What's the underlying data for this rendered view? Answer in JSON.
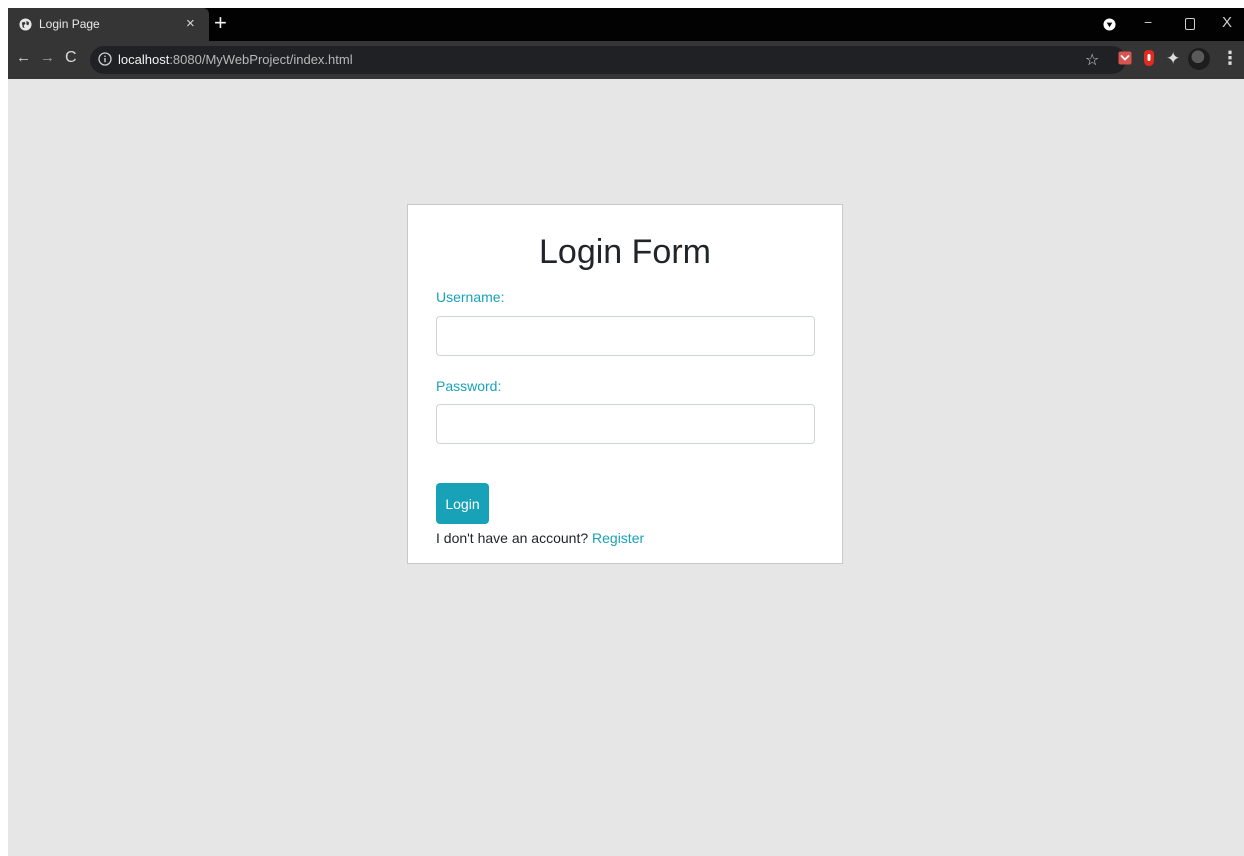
{
  "browser": {
    "tab_title": "Login Page",
    "tab_close": "×",
    "new_tab": "+",
    "url_host": "localhost",
    "url_rest": ":8080/MyWebProject/index.html",
    "icons": {
      "back": "←",
      "forward": "→",
      "reload": "C",
      "star": "☆",
      "minimize": "−",
      "close_window": "X",
      "menu": "⋮",
      "puzzle": "✦"
    }
  },
  "form": {
    "title": "Login Form",
    "username_label": "Username:",
    "username_value": "",
    "password_label": "Password:",
    "password_value": "",
    "login_label": "Login",
    "register_prompt": "I don't have an account?",
    "register_link": "Register"
  },
  "colors": {
    "accent": "#17a2b8",
    "page_background": "#e6e6e6",
    "card_background": "#ffffff"
  }
}
